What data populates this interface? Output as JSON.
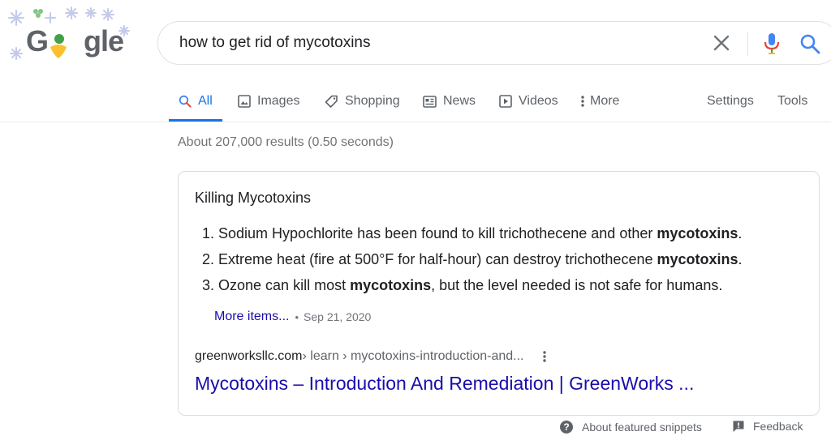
{
  "logo": {
    "letters": [
      "G",
      "o",
      "o",
      "g",
      "l",
      "e"
    ],
    "colors": {
      "text": "#5f6368",
      "accent": "#43a047",
      "heart": "#fbc02d"
    }
  },
  "search": {
    "query": "how to get rid of mycotoxins"
  },
  "icons": {
    "clear": "close-icon",
    "mic": "microphone-icon",
    "search": "magnifier-icon"
  },
  "tabs": [
    {
      "label": "All",
      "icon": "search-icon",
      "active": true
    },
    {
      "label": "Images",
      "icon": "image-icon"
    },
    {
      "label": "Shopping",
      "icon": "tag-icon"
    },
    {
      "label": "News",
      "icon": "newspaper-icon"
    },
    {
      "label": "Videos",
      "icon": "play-icon"
    },
    {
      "label": "More",
      "icon": "kebab-icon"
    }
  ],
  "tools": {
    "settings": "Settings",
    "tools": "Tools"
  },
  "result_stats": "About 207,000 results (0.50 seconds)",
  "snippet": {
    "title": "Killing Mycotoxins",
    "items": [
      {
        "num": "1.",
        "before": "Sodium Hypochlorite has been found to kill trichothecene and other ",
        "bold": "mycotoxins",
        "after": "."
      },
      {
        "num": "2.",
        "before": "Extreme heat (fire at 500°F for half-hour) can destroy trichothecene ",
        "bold": "mycotoxins",
        "after": "."
      },
      {
        "num": "3.",
        "before": "Ozone can kill most ",
        "bold": "mycotoxins",
        "after": ", but the level needed is not safe for humans."
      }
    ],
    "more_items": "More items...",
    "bullet": "•",
    "date": "Sep 21, 2020",
    "cite_domain": "greenworksllc.com",
    "cite_path": " › learn › mycotoxins-introduction-and...",
    "link_title": "Mycotoxins – Introduction And Remediation | GreenWorks ..."
  },
  "footer": {
    "about": "About featured snippets",
    "feedback": "Feedback"
  },
  "colors": {
    "link": "#1a0dab",
    "accent": "#1a73e8",
    "muted": "#70757a",
    "border": "#dadce0"
  }
}
